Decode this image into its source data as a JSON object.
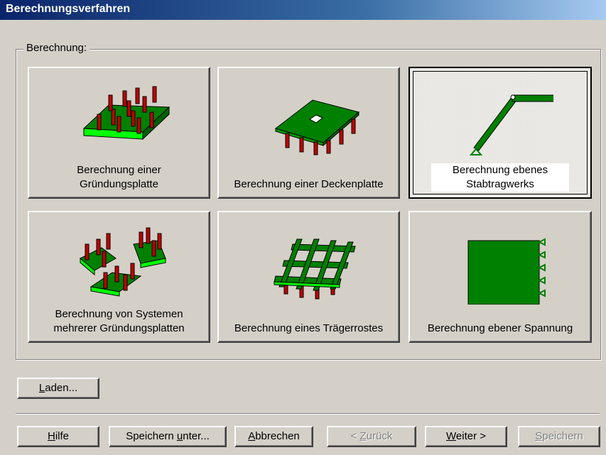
{
  "window": {
    "title": "Berechnungsverfahren"
  },
  "group": {
    "label": "Berechnung:"
  },
  "tiles": [
    {
      "line1": "Berechnung einer",
      "line2": "Gründungsplatte",
      "icon": "foundation-slab-icon"
    },
    {
      "line1": "Berechnung einer Deckenplatte",
      "line2": "",
      "icon": "floor-slab-icon"
    },
    {
      "line1": "Berechnung ebenes",
      "line2": "Stabtragwerks",
      "icon": "plane-frame-icon"
    },
    {
      "line1": "Berechnung von Systemen",
      "line2": "mehrerer Gründungsplatten",
      "icon": "multiple-slabs-icon"
    },
    {
      "line1": "Berechnung eines Trägerrostes",
      "line2": "",
      "icon": "girder-grid-icon"
    },
    {
      "line1": "Berechnung ebener Spannung",
      "line2": "",
      "icon": "plane-stress-icon"
    }
  ],
  "selected_tile": 2,
  "buttons": {
    "laden": {
      "ul": "L",
      "rest": "aden..."
    },
    "hilfe": {
      "ul": "H",
      "rest": "ilfe"
    },
    "speichern_unter": {
      "pre": "Speichern ",
      "ul": "u",
      "rest": "nter..."
    },
    "abbrechen": {
      "ul": "A",
      "rest": "bbrechen"
    },
    "zurueck": {
      "pre": "< ",
      "ul": "Z",
      "rest": "urück"
    },
    "weiter": {
      "ul": "W",
      "rest": "eiter >"
    },
    "speichern": {
      "ul": "S",
      "rest": "peichern"
    }
  },
  "colors": {
    "green": "#008000",
    "lightgreen": "#00ff00",
    "red": "#c00000",
    "title_start": "#0a246a"
  }
}
